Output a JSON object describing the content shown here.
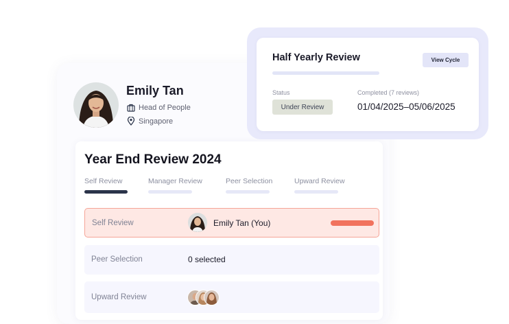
{
  "profile": {
    "name": "Emily Tan",
    "role": "Head of People",
    "location": "Singapore",
    "role_icon": "briefcase-icon",
    "location_icon": "location-pin-icon"
  },
  "review": {
    "title": "Year End Review 2024",
    "steps": [
      {
        "label": "Self Review",
        "active": true
      },
      {
        "label": "Manager Review",
        "active": false
      },
      {
        "label": "Peer Selection",
        "active": false
      },
      {
        "label": "Upward Review",
        "active": false
      }
    ],
    "rows": [
      {
        "label": "Self Review",
        "value": "Emily Tan (You)"
      },
      {
        "label": "Peer Selection",
        "value": "0 selected"
      },
      {
        "label": "Upward Review",
        "value": ""
      }
    ]
  },
  "cycle": {
    "title": "Half Yearly Review",
    "view_button": "View Cycle",
    "status_label": "Status",
    "status_value": "Under Review",
    "completed_label": "Completed (7 reviews)",
    "dates": "01/04/2025–05/06/2025"
  },
  "colors": {
    "accent_red": "#f1725d",
    "active_step": "#2b344a",
    "card_outline": "#e8e9fb"
  }
}
